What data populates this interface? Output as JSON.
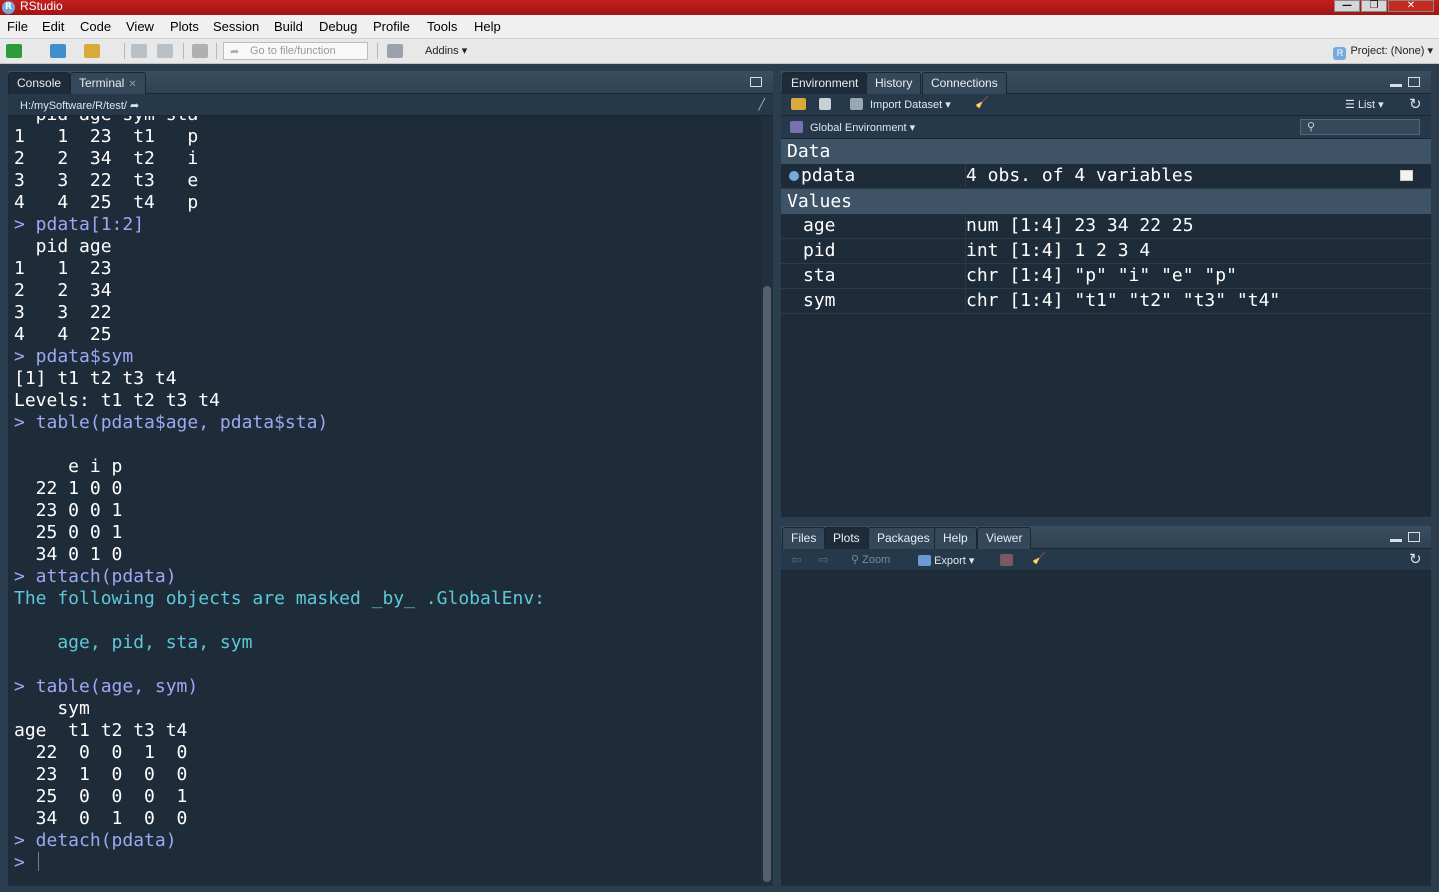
{
  "window": {
    "title": "RStudio",
    "controls": {
      "minimize": "—",
      "restore": "❐",
      "close": "✕"
    }
  },
  "menu": [
    "File",
    "Edit",
    "Code",
    "View",
    "Plots",
    "Session",
    "Build",
    "Debug",
    "Profile",
    "Tools",
    "Help"
  ],
  "toolbar": {
    "goto_placeholder": "Go to file/function",
    "addins": "Addins ▾",
    "project": "Project: (None) ▾"
  },
  "console": {
    "tabs": [
      "Console",
      "Terminal"
    ],
    "path": "H:/mySoftware/R/test/",
    "lines": [
      {
        "t": "  pid age sym sta",
        "k": "out"
      },
      {
        "t": "1   1  23  t1   p",
        "k": "out"
      },
      {
        "t": "2   2  34  t2   i",
        "k": "out"
      },
      {
        "t": "3   3  22  t3   e",
        "k": "out"
      },
      {
        "t": "4   4  25  t4   p",
        "k": "out"
      },
      {
        "t": "> pdata[1:2]",
        "k": "cmd"
      },
      {
        "t": "  pid age",
        "k": "out"
      },
      {
        "t": "1   1  23",
        "k": "out"
      },
      {
        "t": "2   2  34",
        "k": "out"
      },
      {
        "t": "3   3  22",
        "k": "out"
      },
      {
        "t": "4   4  25",
        "k": "out"
      },
      {
        "t": "> pdata$sym",
        "k": "cmd"
      },
      {
        "t": "[1] t1 t2 t3 t4",
        "k": "out"
      },
      {
        "t": "Levels: t1 t2 t3 t4",
        "k": "out"
      },
      {
        "t": "> table(pdata$age, pdata$sta)",
        "k": "cmd"
      },
      {
        "t": "",
        "k": "out"
      },
      {
        "t": "     e i p",
        "k": "out"
      },
      {
        "t": "  22 1 0 0",
        "k": "out"
      },
      {
        "t": "  23 0 0 1",
        "k": "out"
      },
      {
        "t": "  25 0 0 1",
        "k": "out"
      },
      {
        "t": "  34 0 1 0",
        "k": "out"
      },
      {
        "t": "> attach(pdata)",
        "k": "cmd"
      },
      {
        "t": "The following objects are masked _by_ .GlobalEnv:",
        "k": "msg"
      },
      {
        "t": "",
        "k": "out"
      },
      {
        "t": "    age, pid, sta, sym",
        "k": "msg"
      },
      {
        "t": "",
        "k": "out"
      },
      {
        "t": "> table(age, sym)",
        "k": "cmd"
      },
      {
        "t": "    sym",
        "k": "out"
      },
      {
        "t": "age  t1 t2 t3 t4",
        "k": "out"
      },
      {
        "t": "  22  0  0  1  0",
        "k": "out"
      },
      {
        "t": "  23  1  0  0  0",
        "k": "out"
      },
      {
        "t": "  25  0  0  0  1",
        "k": "out"
      },
      {
        "t": "  34  0  1  0  0",
        "k": "out"
      },
      {
        "t": "> detach(pdata)",
        "k": "cmd"
      }
    ],
    "prompt": "> "
  },
  "environment": {
    "tabs": [
      "Environment",
      "History",
      "Connections"
    ],
    "import_dataset": "Import Dataset ▾",
    "list_view": "List ▾",
    "scope": "Global Environment ▾",
    "data_header": "Data",
    "data": [
      {
        "name": "pdata",
        "value": "4 obs. of 4 variables"
      }
    ],
    "values_header": "Values",
    "values": [
      {
        "name": "age",
        "value": "num [1:4] 23 34 22 25"
      },
      {
        "name": "pid",
        "value": "int [1:4] 1 2 3 4"
      },
      {
        "name": "sta",
        "value": "chr [1:4] \"p\" \"i\" \"e\" \"p\""
      },
      {
        "name": "sym",
        "value": "chr [1:4] \"t1\" \"t2\" \"t3\" \"t4\""
      }
    ]
  },
  "files": {
    "tabs": [
      "Files",
      "Plots",
      "Packages",
      "Help",
      "Viewer"
    ],
    "zoom": "Zoom",
    "export": "Export ▾"
  }
}
